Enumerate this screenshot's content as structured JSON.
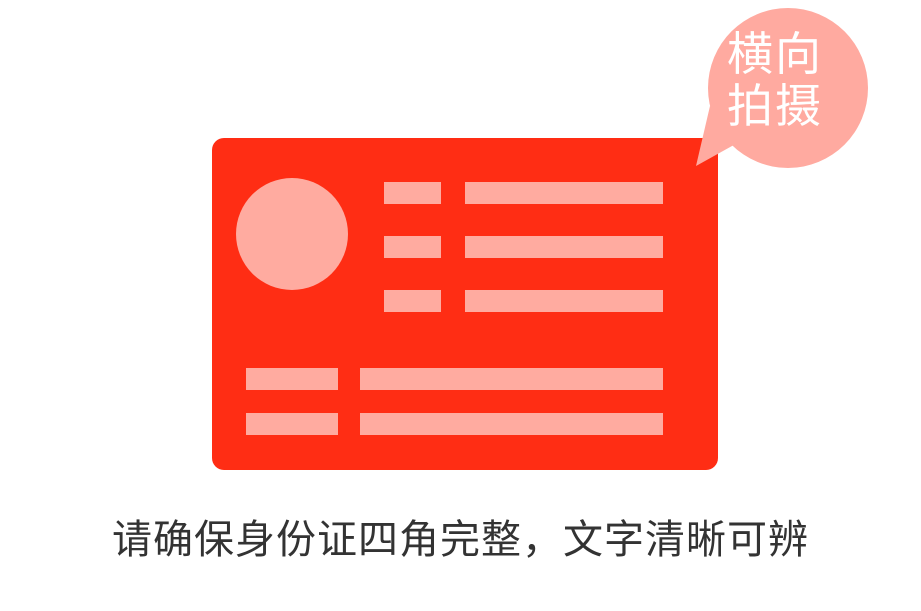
{
  "badge": {
    "line1": "横向",
    "line2": "拍摄"
  },
  "caption": "请确保身份证四角完整，文字清晰可辨",
  "colors": {
    "card": "#ff2d14",
    "placeholder": "#ffaba0",
    "bubble": "#ffaaa0",
    "caption_text": "#333333"
  },
  "icons": {
    "card": "id-card-illustration",
    "photo": "portrait-placeholder",
    "bubble": "speech-bubble"
  }
}
